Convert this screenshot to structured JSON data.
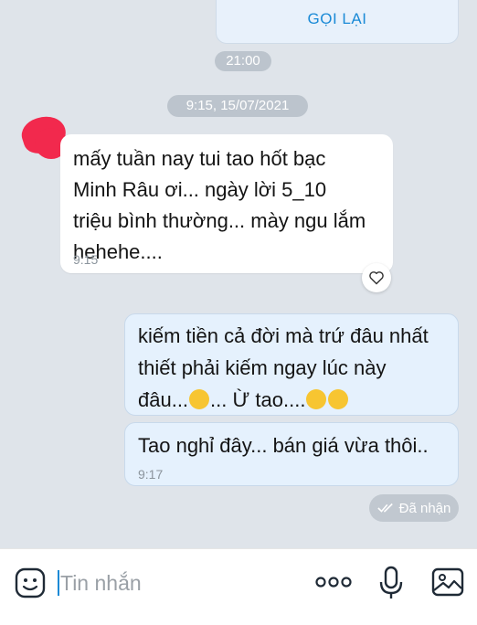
{
  "callback": {
    "label": "GỌI LẠI"
  },
  "separators": {
    "time_top": "21:00",
    "date_time": "9:15, 15/07/2021"
  },
  "incoming": {
    "lines": [
      "mấy tuần nay tui tao hốt bạc",
      "Minh Râu ơi... ngày lời 5_10",
      "triệu bình thường... mày ngu lắm",
      "hehehe...."
    ],
    "time": "9:15"
  },
  "outgoing": [
    {
      "lines": [
        "kiếm tiền cả đời mà trứ đâu nhất",
        "thiết phải kiếm ngay lúc này",
        "đâu..."
      ],
      "after_emoji1": "... Ừ tao....",
      "time": ""
    },
    {
      "text": "Tao nghỉ đây... bán giá vừa thôi..",
      "time": "9:17"
    }
  ],
  "status": {
    "label": "Đã nhận",
    "icon": "double-check-icon"
  },
  "input": {
    "placeholder": "Tin nhắn"
  },
  "icons": [
    "emoji-icon",
    "more-icon",
    "microphone-icon",
    "image-icon",
    "heart-icon"
  ],
  "colors": {
    "accent": "#1a8ad6",
    "outgoing_bg": "#e5f1fd",
    "background": "#dfe4ea"
  }
}
